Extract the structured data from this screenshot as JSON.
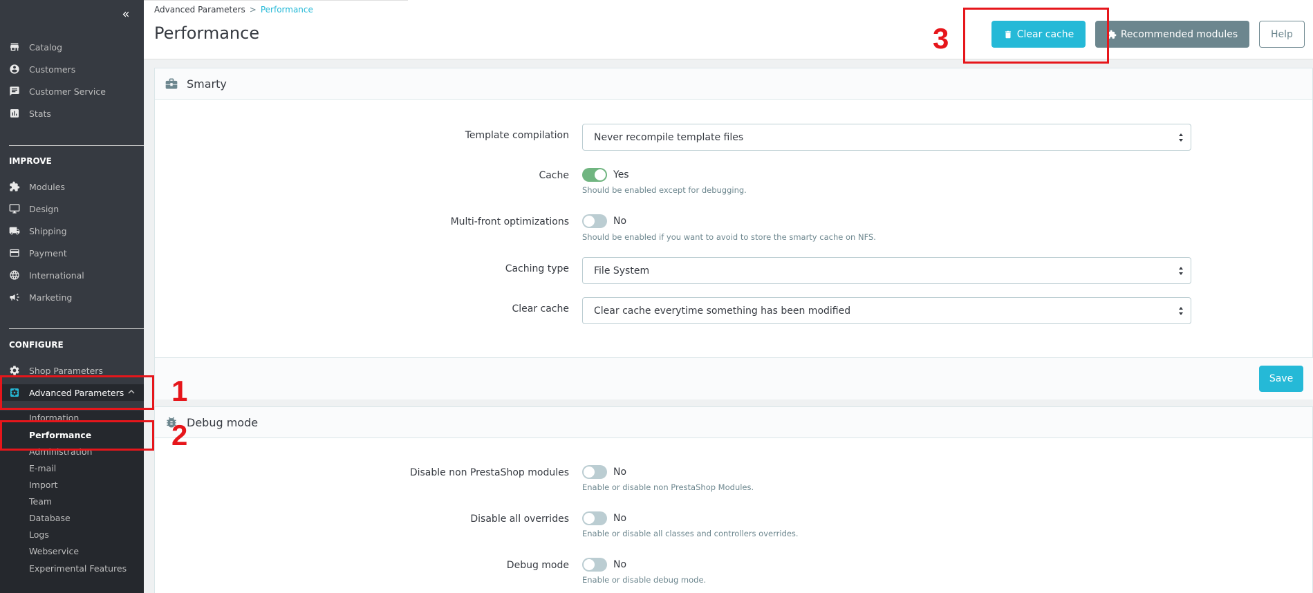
{
  "sidebar": {
    "collapse_glyph": "«",
    "items_top": [
      {
        "label": "Catalog",
        "icon": "store-icon"
      },
      {
        "label": "Customers",
        "icon": "account-circle-icon"
      },
      {
        "label": "Customer Service",
        "icon": "chat-icon"
      },
      {
        "label": "Stats",
        "icon": "assessment-icon"
      }
    ],
    "improve_title": "IMPROVE",
    "items_improve": [
      {
        "label": "Modules",
        "icon": "puzzle-icon"
      },
      {
        "label": "Design",
        "icon": "desktop-icon"
      },
      {
        "label": "Shipping",
        "icon": "truck-icon"
      },
      {
        "label": "Payment",
        "icon": "credit-card-icon"
      },
      {
        "label": "International",
        "icon": "globe-icon"
      },
      {
        "label": "Marketing",
        "icon": "megaphone-icon"
      }
    ],
    "configure_title": "CONFIGURE",
    "items_configure": [
      {
        "label": "Shop Parameters",
        "icon": "settings-icon"
      },
      {
        "label": "Advanced Parameters",
        "icon": "settings-applications-icon"
      }
    ],
    "submenu": [
      "Information",
      "Performance",
      "Administration",
      "E-mail",
      "Import",
      "Team",
      "Database",
      "Logs",
      "Webservice",
      "Experimental Features"
    ]
  },
  "header": {
    "breadcrumb_parent": "Advanced Parameters",
    "breadcrumb_sep": ">",
    "breadcrumb_current": "Performance",
    "title": "Performance",
    "clear_cache_label": "Clear cache",
    "recommended_label": "Recommended modules",
    "help_label": "Help"
  },
  "annotations": {
    "n1": "1",
    "n2": "2",
    "n3": "3",
    "color": "#e6161b"
  },
  "smarty": {
    "title": "Smarty",
    "template_compilation_label": "Template compilation",
    "template_compilation_value": "Never recompile template files",
    "cache_label": "Cache",
    "cache_state": "Yes",
    "cache_help": "Should be enabled except for debugging.",
    "multifront_label": "Multi-front optimizations",
    "multifront_state": "No",
    "multifront_help": "Should be enabled if you want to avoid to store the smarty cache on NFS.",
    "caching_type_label": "Caching type",
    "caching_type_value": "File System",
    "clear_cache_label": "Clear cache",
    "clear_cache_value": "Clear cache everytime something has been modified",
    "save_label": "Save"
  },
  "debug": {
    "title": "Debug mode",
    "disable_non_ps_label": "Disable non PrestaShop modules",
    "disable_non_ps_state": "No",
    "disable_non_ps_help": "Enable or disable non PrestaShop Modules.",
    "disable_overrides_label": "Disable all overrides",
    "disable_overrides_state": "No",
    "disable_overrides_help": "Enable or disable all classes and controllers overrides.",
    "debug_mode_label": "Debug mode",
    "debug_mode_state": "No",
    "debug_mode_help": "Enable or disable debug mode."
  },
  "colors": {
    "accent": "#25b9d7",
    "sidebar": "#363a41",
    "toggle_on": "#70b580",
    "annotation": "#e6161b"
  }
}
